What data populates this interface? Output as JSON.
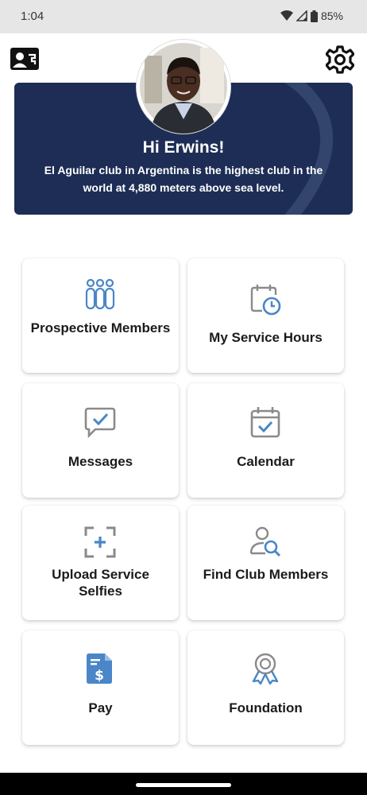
{
  "status": {
    "time": "1:04",
    "battery": "85%"
  },
  "header": {
    "greeting": "Hi Erwins!",
    "fact": "El Aguilar club in Argentina is the highest club in the world at 4,880 meters above sea level."
  },
  "icons": {
    "contact": "contact-card-icon",
    "settings": "gear-icon",
    "accent": "#4a86c8",
    "muted": "#9a9a9a",
    "banner_bg": "#1d2d55"
  },
  "tiles": [
    {
      "label": "Prospective Members",
      "icon": "people-group-icon"
    },
    {
      "label": "My Service Hours",
      "icon": "clock-calendar-icon"
    },
    {
      "label": "Messages",
      "icon": "message-check-icon"
    },
    {
      "label": "Calendar",
      "icon": "calendar-check-icon"
    },
    {
      "label": "Upload Service Selfies",
      "icon": "camera-frame-plus-icon"
    },
    {
      "label": "Find Club Members",
      "icon": "user-search-icon"
    },
    {
      "label": "Pay",
      "icon": "dollar-document-icon"
    },
    {
      "label": "Foundation",
      "icon": "award-ribbon-icon"
    }
  ]
}
